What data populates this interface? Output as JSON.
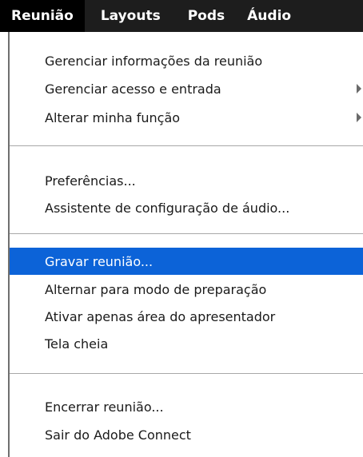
{
  "menubar": {
    "items": [
      {
        "label": "Reunião",
        "active": true
      },
      {
        "label": "Layouts"
      },
      {
        "label": "Pods"
      },
      {
        "label": "Áudio"
      }
    ]
  },
  "menu": {
    "groups": [
      [
        {
          "label": "Gerenciar informações da reunião"
        },
        {
          "label": "Gerenciar acesso e entrada",
          "submenu": true
        },
        {
          "label": "Alterar minha função",
          "submenu": true
        }
      ],
      [
        {
          "label": "Preferências..."
        },
        {
          "label": "Assistente de configuração de áudio..."
        }
      ],
      [
        {
          "label": "Gravar reunião...",
          "highlighted": true
        },
        {
          "label": "Alternar para modo de preparação"
        },
        {
          "label": "Ativar apenas área do apresentador"
        },
        {
          "label": "Tela cheia"
        }
      ],
      [
        {
          "label": "Encerrar reunião..."
        },
        {
          "label": "Sair do Adobe Connect"
        }
      ]
    ]
  },
  "colors": {
    "menubar_bg": "#1d1d1d",
    "active_menu_bg": "#000000",
    "highlight": "#0c63d8",
    "separator": "#a8a8a8"
  }
}
